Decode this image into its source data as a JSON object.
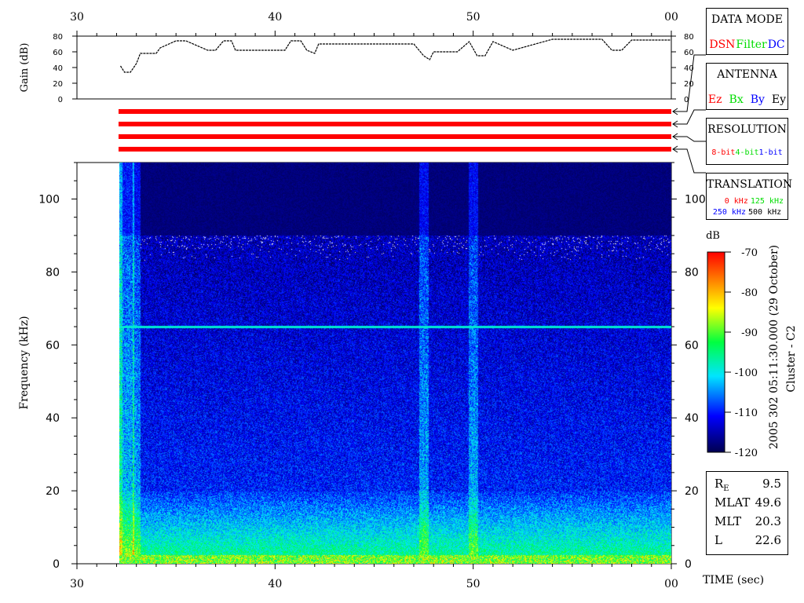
{
  "colors": {
    "red": "#ff0000",
    "green": "#00dd00",
    "blue": "#0000ff",
    "black": "#000000",
    "background": "#000850"
  },
  "legend_boxes": {
    "data_mode": {
      "title": "DATA MODE",
      "items": [
        {
          "text": "DSN",
          "color": "#ff0000"
        },
        {
          "text": "Filter",
          "color": "#00dd00"
        },
        {
          "text": "DC",
          "color": "#0000ff"
        }
      ]
    },
    "antenna": {
      "title": "ANTENNA",
      "items": [
        {
          "text": "Ez",
          "color": "#ff0000"
        },
        {
          "text": "Bx",
          "color": "#00dd00"
        },
        {
          "text": "By",
          "color": "#0000ff"
        },
        {
          "text": "Ey",
          "color": "#000000"
        }
      ]
    },
    "resolution": {
      "title": "RESOLUTION",
      "items": [
        {
          "text": "8-bit",
          "color": "#ff0000"
        },
        {
          "text": "4-bit",
          "color": "#00dd00"
        },
        {
          "text": "1-bit",
          "color": "#0000ff"
        }
      ]
    },
    "translation": {
      "title": "TRANSLATION",
      "row1": [
        {
          "text": "0 kHz",
          "color": "#ff0000"
        },
        {
          "text": "125 kHz",
          "color": "#00dd00"
        }
      ],
      "row2": [
        {
          "text": "250 kHz",
          "color": "#0000ff"
        },
        {
          "text": "500 kHz",
          "color": "#000000"
        }
      ]
    }
  },
  "info_box": {
    "rows": [
      {
        "key": "R",
        "sub": "E",
        "value": "9.5"
      },
      {
        "key": "MLAT",
        "sub": "",
        "value": "49.6"
      },
      {
        "key": "MLT",
        "sub": "",
        "value": "20.3"
      },
      {
        "key": "L",
        "sub": "",
        "value": "22.6"
      }
    ]
  },
  "colorbar": {
    "unit": "dB",
    "ticks": [
      "-70",
      "-80",
      "-90",
      "-100",
      "-110",
      "-120"
    ],
    "range": [
      -120,
      -70
    ]
  },
  "side_caption": {
    "date": "2005 302 05:11:30.000 (29 October)",
    "spacecraft": "Cluster - C2"
  },
  "chart_data": [
    {
      "type": "line",
      "panel": "gain",
      "ylabel": "Gain (dB)",
      "xlabel": "",
      "x_tick_labels": [
        "30",
        "40",
        "50",
        "00"
      ],
      "y_tick_labels": [
        "0",
        "20",
        "40",
        "60",
        "80"
      ],
      "xlim": [
        30,
        60
      ],
      "ylim": [
        0,
        80
      ],
      "x": [
        32.2,
        32.4,
        32.7,
        33.0,
        33.2,
        34.0,
        34.2,
        35.0,
        35.5,
        36.6,
        37.0,
        37.4,
        37.8,
        38.0,
        40.5,
        40.8,
        41.3,
        41.6,
        42.0,
        42.2,
        47.0,
        47.5,
        47.8,
        48.0,
        49.2,
        49.8,
        50.2,
        50.6,
        51.0,
        52.0,
        54.0,
        56.5,
        57.0,
        57.5,
        58.0,
        60.0
      ],
      "values": [
        42,
        34,
        34,
        45,
        58,
        58,
        65,
        74,
        74,
        62,
        62,
        74,
        74,
        62,
        62,
        74,
        74,
        62,
        58,
        70,
        70,
        55,
        50,
        60,
        60,
        73,
        55,
        55,
        73,
        62,
        76,
        76,
        62,
        62,
        75,
        75
      ]
    },
    {
      "type": "heatmap",
      "panel": "spectrogram",
      "ylabel": "Frequency (kHz)",
      "xlabel": "TIME (sec)",
      "x_tick_labels": [
        "30",
        "40",
        "50",
        "00"
      ],
      "y_tick_labels": [
        "0",
        "20",
        "40",
        "60",
        "80",
        "100"
      ],
      "xlim": [
        30,
        60
      ],
      "ylim": [
        0,
        110
      ],
      "data_start_x": 32.1,
      "persistent_line_khz": 65,
      "bursts_x": [
        32.1,
        33.0,
        47.5,
        50.0
      ],
      "colorbar_range_db": [
        -120,
        -70
      ]
    }
  ]
}
